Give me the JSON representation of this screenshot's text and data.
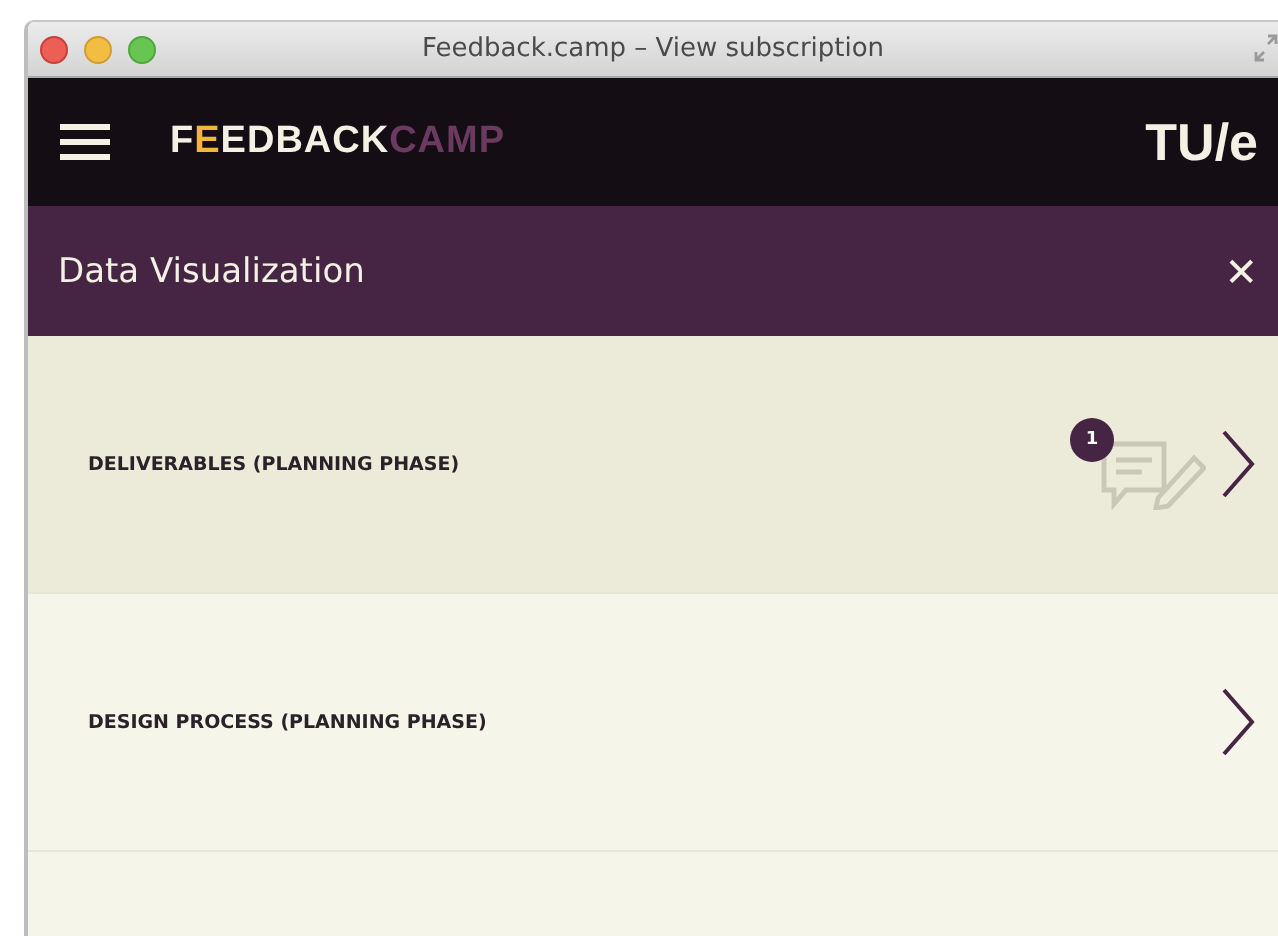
{
  "window": {
    "title": "Feedback.camp – View subscription"
  },
  "header": {
    "logo": [
      {
        "text": "F",
        "kind": "plain"
      },
      {
        "text": "E",
        "kind": "accent"
      },
      {
        "text": "EDBACK",
        "kind": "plain"
      },
      {
        "text": "CAMP",
        "kind": "muted"
      }
    ],
    "brand": "TU/e"
  },
  "panel": {
    "title": "Data Visualization",
    "close": "✕"
  },
  "items": [
    {
      "label": "DELIVERABLES (PLANNING PHASE)",
      "selected": true,
      "comment_count": "1"
    },
    {
      "label": "DESIGN PROCESS (PLANNING PHASE)",
      "selected": false
    }
  ]
}
